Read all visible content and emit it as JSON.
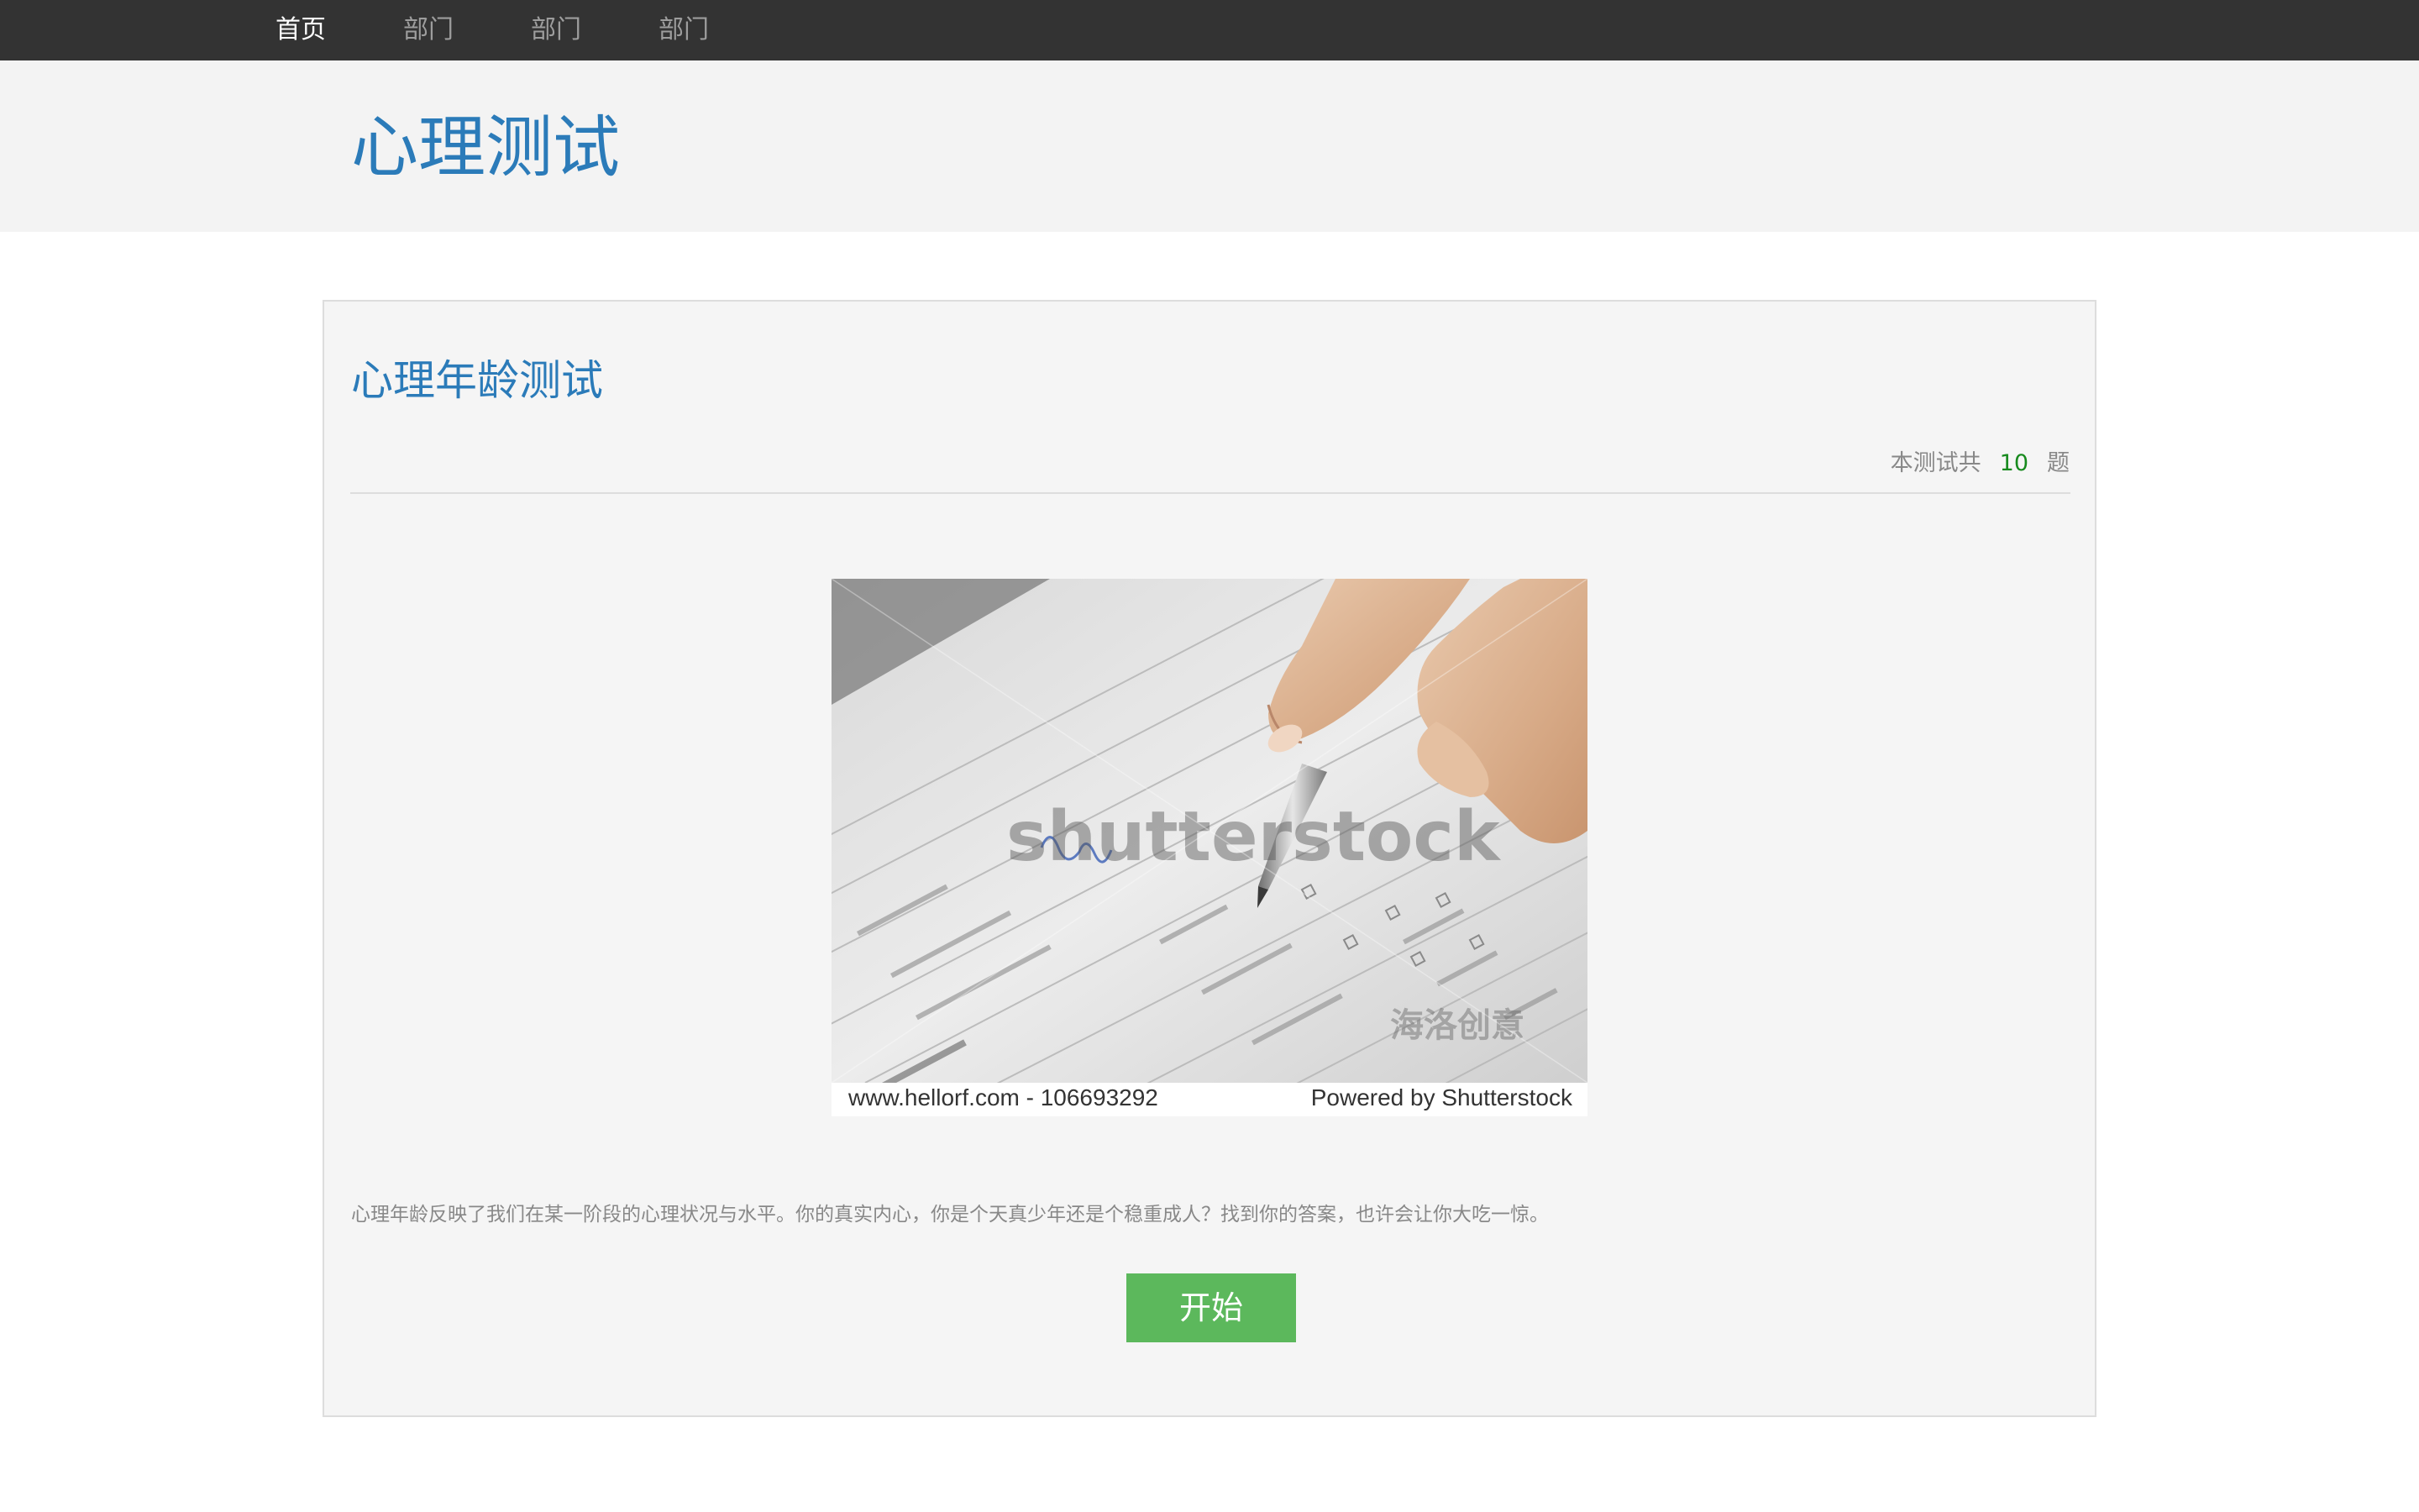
{
  "nav": {
    "items": [
      {
        "label": "首页",
        "active": true
      },
      {
        "label": "部门",
        "active": false
      },
      {
        "label": "部门",
        "active": false
      },
      {
        "label": "部门",
        "active": false
      }
    ]
  },
  "header": {
    "title": "心理测试"
  },
  "quiz": {
    "title": "心理年龄测试",
    "count_prefix": "本测试共",
    "count_value": "10",
    "count_suffix": "题",
    "image": {
      "watermark": "shutterstock",
      "watermark_cn": "海洛创意",
      "caption_left": "www.hellorf.com - 106693292",
      "caption_right": "Powered by Shutterstock"
    },
    "description": "心理年龄反映了我们在某一阶段的心理状况与水平。你的真实内心，你是个天真少年还是个稳重成人？找到你的答案，也许会让你大吃一惊。",
    "start_label": "开始"
  },
  "colors": {
    "navbar_bg": "#333333",
    "title_blue": "#2b7bb9",
    "count_green": "#178a1e",
    "button_green": "#5cb85c"
  }
}
